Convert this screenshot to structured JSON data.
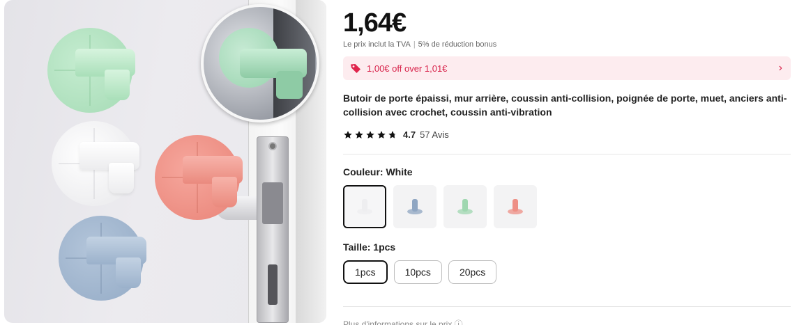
{
  "product": {
    "price": "1,64€",
    "tax_note": "Le prix inclut la TVA",
    "bonus_note": "5% de réduction bonus",
    "promo_text": "1,00€ off over 1,01€",
    "title": "Butoir de porte épaissi, mur arrière, coussin anti-collision, poignée de porte, muet, anciers anti-collision avec crochet, coussin anti-vibration",
    "rating": {
      "score": "4.7",
      "stars": 4.7,
      "reviews": "57 Avis"
    }
  },
  "color": {
    "label": "Couleur: White",
    "options": [
      {
        "name": "White",
        "color": "#eeeef0",
        "selected": true
      },
      {
        "name": "Blue",
        "color": "#8fa6c2",
        "selected": false
      },
      {
        "name": "Green",
        "color": "#9fd7b0",
        "selected": false
      },
      {
        "name": "Pink",
        "color": "#ee8f85",
        "selected": false
      }
    ]
  },
  "size": {
    "label": "Taille: 1pcs",
    "options": [
      "1pcs",
      "10pcs",
      "20pcs"
    ],
    "selected_index": 0
  },
  "more_info": "Plus d'informations sur le prix ⓘ",
  "colors": {
    "promo_bg": "#fdecef",
    "promo_text": "#d8224a",
    "text": "#222222"
  },
  "icons": {
    "promo": "tag-icon",
    "promo_arrow": "chevron-right-icon",
    "rating": "star-icon"
  }
}
